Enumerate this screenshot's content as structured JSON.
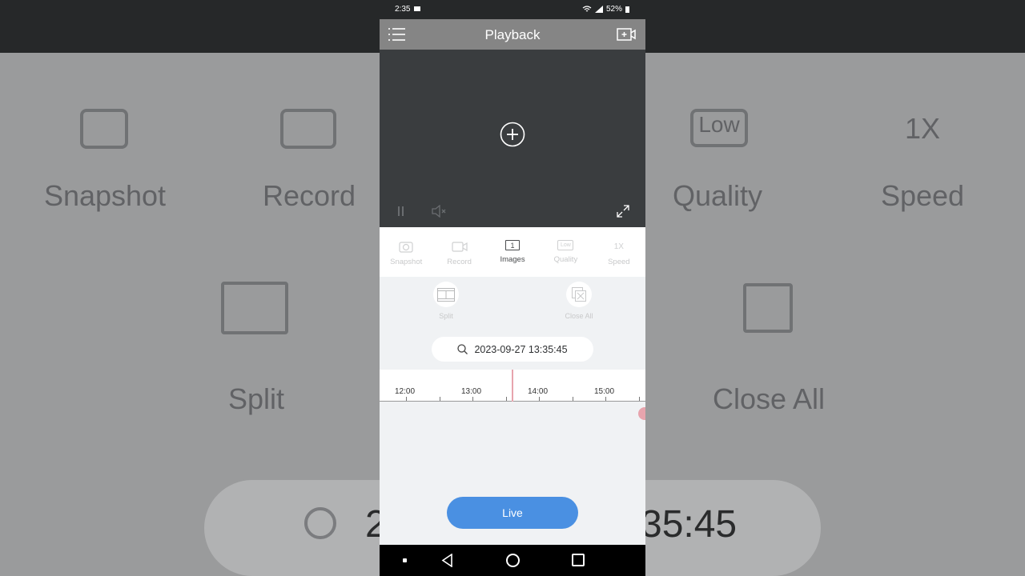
{
  "status_bar": {
    "time": "2:35",
    "battery": "52%"
  },
  "header": {
    "title": "Playback"
  },
  "toolbar": {
    "items": [
      {
        "label": "Snapshot",
        "icon": "camera-icon",
        "active": false
      },
      {
        "label": "Record",
        "icon": "video-camera-icon",
        "active": false
      },
      {
        "label": "Images",
        "icon": "image-count-icon",
        "icon_text": "1",
        "active": true
      },
      {
        "label": "Quality",
        "icon": "quality-icon",
        "icon_text": "Low",
        "active": false
      },
      {
        "label": "Speed",
        "icon": "speed-icon",
        "icon_text": "1X",
        "active": false
      }
    ]
  },
  "subtools": {
    "split_label": "Split",
    "close_all_label": "Close All"
  },
  "search": {
    "datetime": "2023-09-27 13:35:45"
  },
  "timeline": {
    "ticks": [
      "12:00",
      "13:00",
      "14:00",
      "15:00"
    ]
  },
  "live_button": {
    "label": "Live"
  },
  "background": {
    "row1": [
      "Snapshot",
      "Record",
      "Quality",
      "Speed"
    ],
    "row2": [
      "Split",
      "Close All"
    ],
    "icon_texts": {
      "quality": "Low",
      "speed": "1X"
    },
    "search_left": "2",
    "search_right": "35:45"
  },
  "colors": {
    "accent": "#4a90e2",
    "header": "#858585",
    "video_bg": "#3a3d3f",
    "cursor": "#e7a4ad"
  }
}
